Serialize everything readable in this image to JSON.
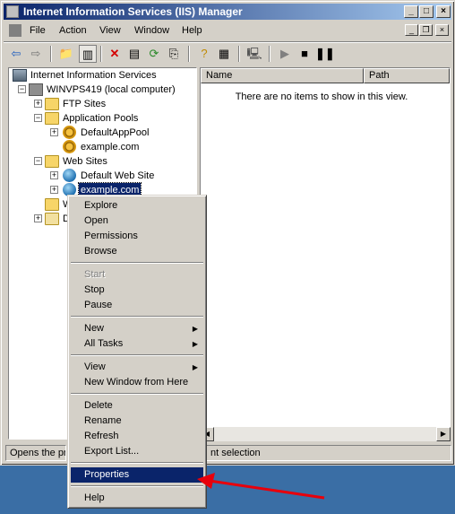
{
  "window": {
    "title": "Internet Information Services (IIS) Manager"
  },
  "menubar": {
    "items": [
      "File",
      "Action",
      "View",
      "Window",
      "Help"
    ]
  },
  "tree": {
    "root": "Internet Information Services",
    "computer": "WINVPS419 (local computer)",
    "ftp_sites": "FTP Sites",
    "app_pools": "Application Pools",
    "pool_default": "DefaultAppPool",
    "pool_example": "example.com",
    "web_sites": "Web Sites",
    "site_default": "Default Web Site",
    "site_example": "example.com",
    "partial_1": "W",
    "partial_2": "D"
  },
  "list": {
    "columns": [
      "Name",
      "Path"
    ],
    "empty_message": "There are no items to show in this view."
  },
  "status": {
    "left": "Opens the pro",
    "right": "nt selection"
  },
  "context_menu": {
    "explore": "Explore",
    "open": "Open",
    "permissions": "Permissions",
    "browse": "Browse",
    "start": "Start",
    "stop": "Stop",
    "pause": "Pause",
    "new": "New",
    "all_tasks": "All Tasks",
    "view": "View",
    "new_window": "New Window from Here",
    "delete": "Delete",
    "rename": "Rename",
    "refresh": "Refresh",
    "export_list": "Export List...",
    "properties": "Properties",
    "help": "Help"
  },
  "colors": {
    "selection": "#0a246a",
    "arrow": "#e8000b",
    "desktop": "#3a6ea5"
  }
}
